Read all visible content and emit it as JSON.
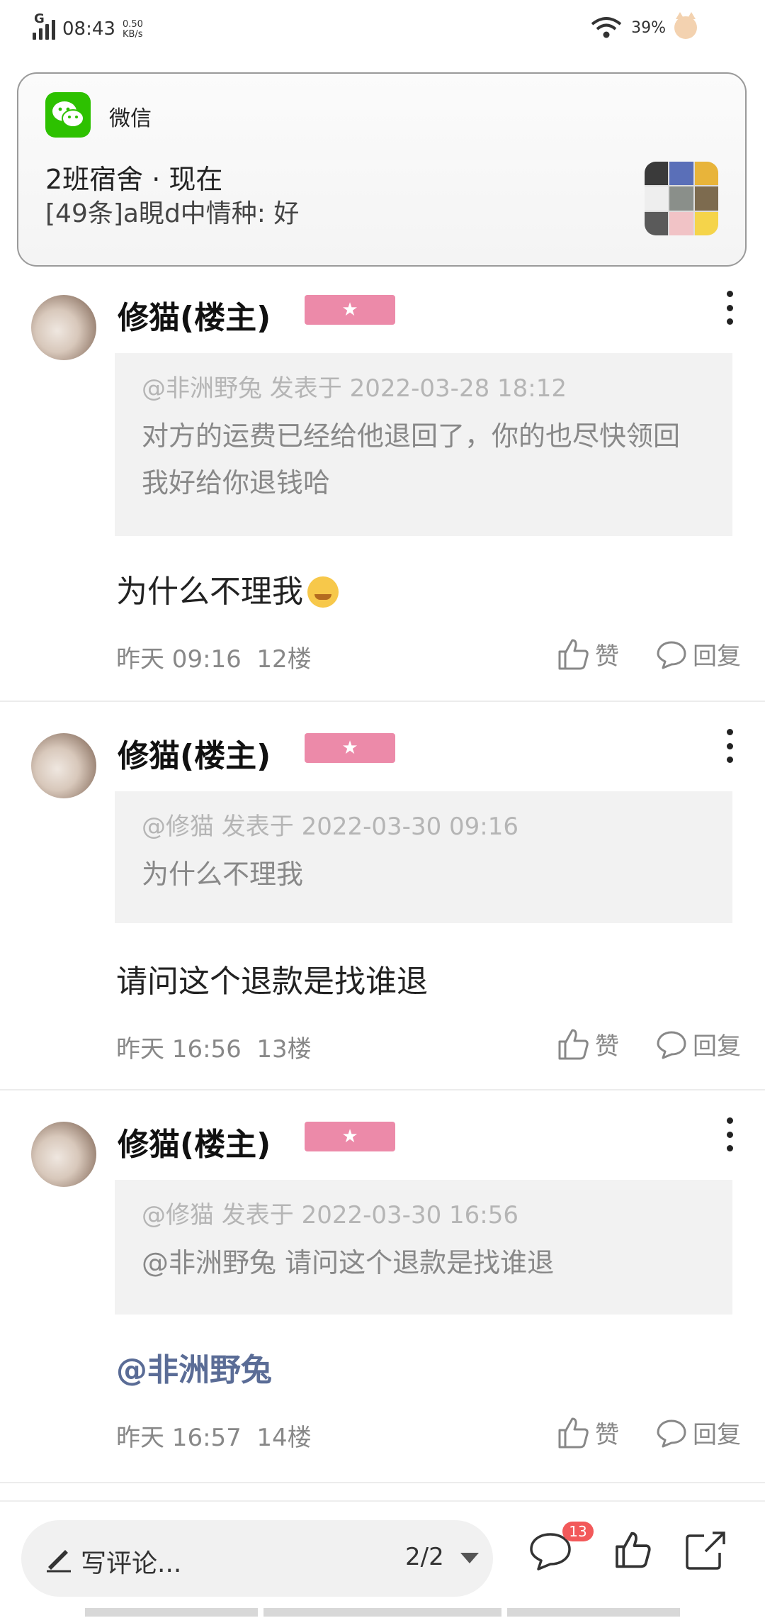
{
  "status_bar": {
    "network": "G",
    "time": "08:43",
    "speed_value": "0.50",
    "speed_unit": "KB/s",
    "battery": "39%"
  },
  "notification": {
    "app_name": "微信",
    "title": "2班宿舍 · 现在",
    "body": "[49条]a睍d中情种: 好"
  },
  "posts": [
    {
      "username": "修猫(楼主)",
      "quote_meta": "@非洲野兔 发表于 2022-03-28 18:12",
      "quote_text": "对方的运费已经给他退回了，你的也尽快领回我好给你退钱哈",
      "content": "为什么不理我",
      "time": "昨天 09:16",
      "floor": "12楼",
      "like": "赞",
      "reply": "回复"
    },
    {
      "username": "修猫(楼主)",
      "quote_meta": "@修猫 发表于 2022-03-30 09:16",
      "quote_text": "为什么不理我",
      "content": "请问这个退款是找谁退",
      "time": "昨天 16:56",
      "floor": "13楼",
      "like": "赞",
      "reply": "回复"
    },
    {
      "username": "修猫(楼主)",
      "quote_meta": "@修猫 发表于 2022-03-30 16:56",
      "quote_text": "@非洲野兔 请问这个退款是找谁退",
      "content": "@非洲野兔",
      "time": "昨天 16:57",
      "floor": "14楼",
      "like": "赞",
      "reply": "回复"
    }
  ],
  "bottom_bar": {
    "comment_placeholder": "写评论...",
    "page_indicator": "2/2",
    "comment_count": "13",
    "icons": [
      "pen-icon",
      "comment-icon",
      "thumbs-up-icon",
      "share-icon"
    ]
  },
  "colors": {
    "badge": "#ec8aa9",
    "wechat_green": "#2dc100",
    "mention": "#5a6c96",
    "count_badge": "#f2595a"
  }
}
